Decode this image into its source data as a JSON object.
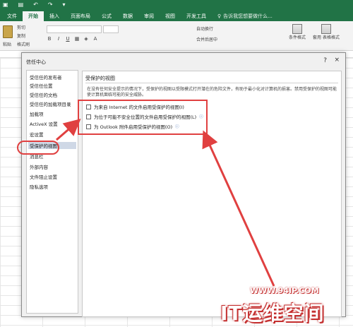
{
  "tabs": [
    "文件",
    "开始",
    "插入",
    "页面布局",
    "公式",
    "数据",
    "审阅",
    "视图",
    "开发工具"
  ],
  "tell_me": "告诉我您想要做什么...",
  "ribbon": {
    "paste": "粘贴",
    "cut": "剪切",
    "copy": "复制",
    "format_painter": "格式刷",
    "wrap_text": "自动换行",
    "merge_center": "合并后居中",
    "conditional_format": "条件格式",
    "table_format": "套用\n表格格式"
  },
  "dialog": {
    "title": "信任中心",
    "help": "?",
    "close": "×",
    "sidebar": [
      "受信任的发布者",
      "受信任位置",
      "受信任的文档",
      "受信任的加载项目录",
      "加载项",
      "ActiveX 设置",
      "宏设置",
      "受保护的视图",
      "消息栏",
      "外部内容",
      "文件阻止设置",
      "隐私选项"
    ],
    "selected_index": 7,
    "section_title": "受保护的视图",
    "description": "在没有任何安全提示的情况下，受保护的视图以受限模式打开潜在的危险文件，有助于最小化对计算机的损害。禁用受保护的视图可能使计算机面临可能的安全威胁。",
    "options": [
      {
        "label": "为来自 Internet 的文件启用受保护的视图(I)",
        "checked": false
      },
      {
        "label": "为位于可能不安全位置的文件启用受保护的视图(L)",
        "checked": false
      },
      {
        "label": "为 Outlook 附件启用受保护的视图(O)",
        "checked": false
      }
    ]
  },
  "watermark": {
    "url": "WWW.94IP.COM",
    "text": "IT运维空间"
  },
  "colors": {
    "excel_green": "#217346",
    "highlight_red": "#e04040"
  }
}
